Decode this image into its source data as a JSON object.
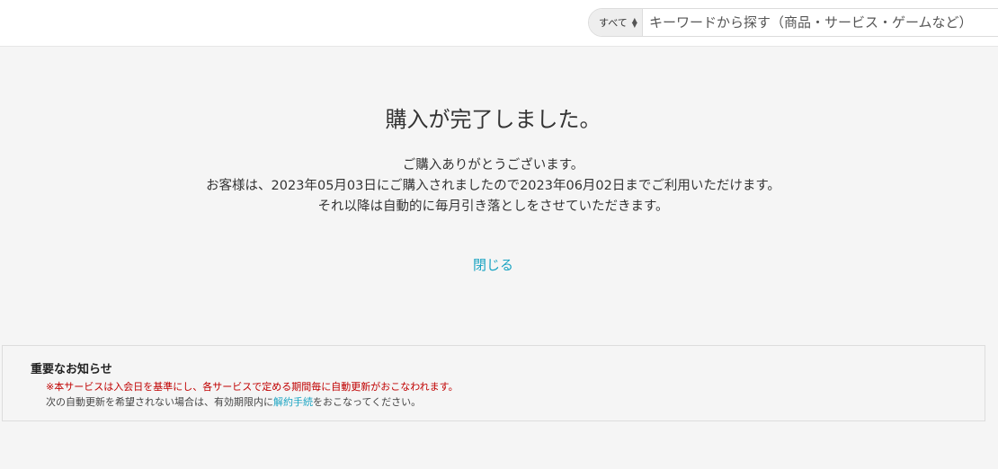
{
  "search": {
    "category": "すべて",
    "category_icon": "chevron-updown-icon",
    "placeholder": "キーワードから探す（商品・サービス・ゲームなど）"
  },
  "main": {
    "title": "購入が完了しました。",
    "thanks": "ご購入ありがとうございます。",
    "usage": "お客様は、2023年05月03日にご購入されましたので2023年06月02日までご利用いただけます。",
    "auto_charge": "それ以降は自動的に毎月引き落としをさせていただきます。",
    "close_label": "閉じる"
  },
  "notice": {
    "title": "重要なお知らせ",
    "line1": "※本サービスは入会日を基準にし、各サービスで定める期間毎に自動更新がおこなわれます。",
    "line2_prefix": "次の自動更新を希望されない場合は、有効期限内に",
    "line2_link": "解約手続",
    "line2_suffix": "をおこなってください。"
  },
  "colors": {
    "link": "#1ba4c2",
    "notice_warning": "#c00000",
    "background": "#f5f5f5"
  }
}
